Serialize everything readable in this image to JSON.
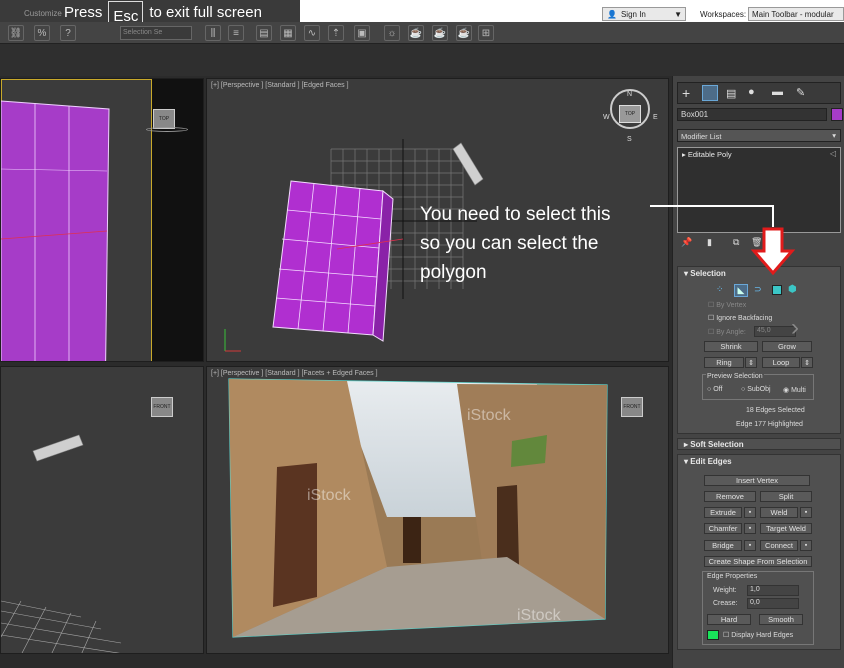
{
  "topbar": {
    "menu_customize": "Customize",
    "fs_press": "Press",
    "fs_key": "Esc",
    "fs_rest": "to exit full screen",
    "signin": "Sign In",
    "workspaces_label": "Workspaces:",
    "workspace_value": "Main Toolbar - modular"
  },
  "toolbar": {
    "selection_set": "Selection Se"
  },
  "viewports": {
    "top_right_label": "[+] [Perspective ] [Standard ] [Edged Faces ]",
    "bottom_right_label": "[+] [Perspective ] [Standard ] [Facets + Edged Faces ]",
    "viewcube_top": "TOP",
    "viewcube_front": "FRONT",
    "compass": {
      "n": "N",
      "w": "W",
      "e": "E",
      "s": "S"
    },
    "watermark": "iStock"
  },
  "command_panel": {
    "object_name": "Box001",
    "object_color": "#a63cc8",
    "modifier_list": "Modifier List",
    "stack_item": "Editable Poly",
    "selection": {
      "title": "Selection",
      "by_vertex": "By Vertex",
      "ignore_backfacing": "Ignore Backfacing",
      "by_angle": "By Angle:",
      "by_angle_value": "45,0",
      "shrink": "Shrink",
      "grow": "Grow",
      "ring": "Ring",
      "loop": "Loop",
      "preview_selection": "Preview Selection",
      "preview_options": [
        "Off",
        "SubObj",
        "Multi"
      ],
      "status1": "18 Edges Selected",
      "status2": "Edge 177 Highlighted"
    },
    "soft_selection": "Soft Selection",
    "edit_edges": {
      "title": "Edit Edges",
      "insert_vertex": "Insert Vertex",
      "remove": "Remove",
      "split": "Split",
      "extrude": "Extrude",
      "weld": "Weld",
      "chamfer": "Chamfer",
      "target_weld": "Target Weld",
      "bridge": "Bridge",
      "connect": "Connect",
      "create_shape": "Create Shape From Selection",
      "edge_properties": "Edge Properties",
      "weight_label": "Weight:",
      "weight_value": "1,0",
      "crease_label": "Crease:",
      "crease_value": "0,0",
      "hard": "Hard",
      "smooth": "Smooth",
      "display_hard_edges": "Display Hard Edges",
      "hard_edge_color": "#19e35a"
    }
  },
  "annotation": {
    "line1": "You need to select this",
    "line2": "so you can select the",
    "line3": "polygon"
  },
  "colors": {
    "arrow": "#e11b1b",
    "object": "#b02fd0"
  }
}
